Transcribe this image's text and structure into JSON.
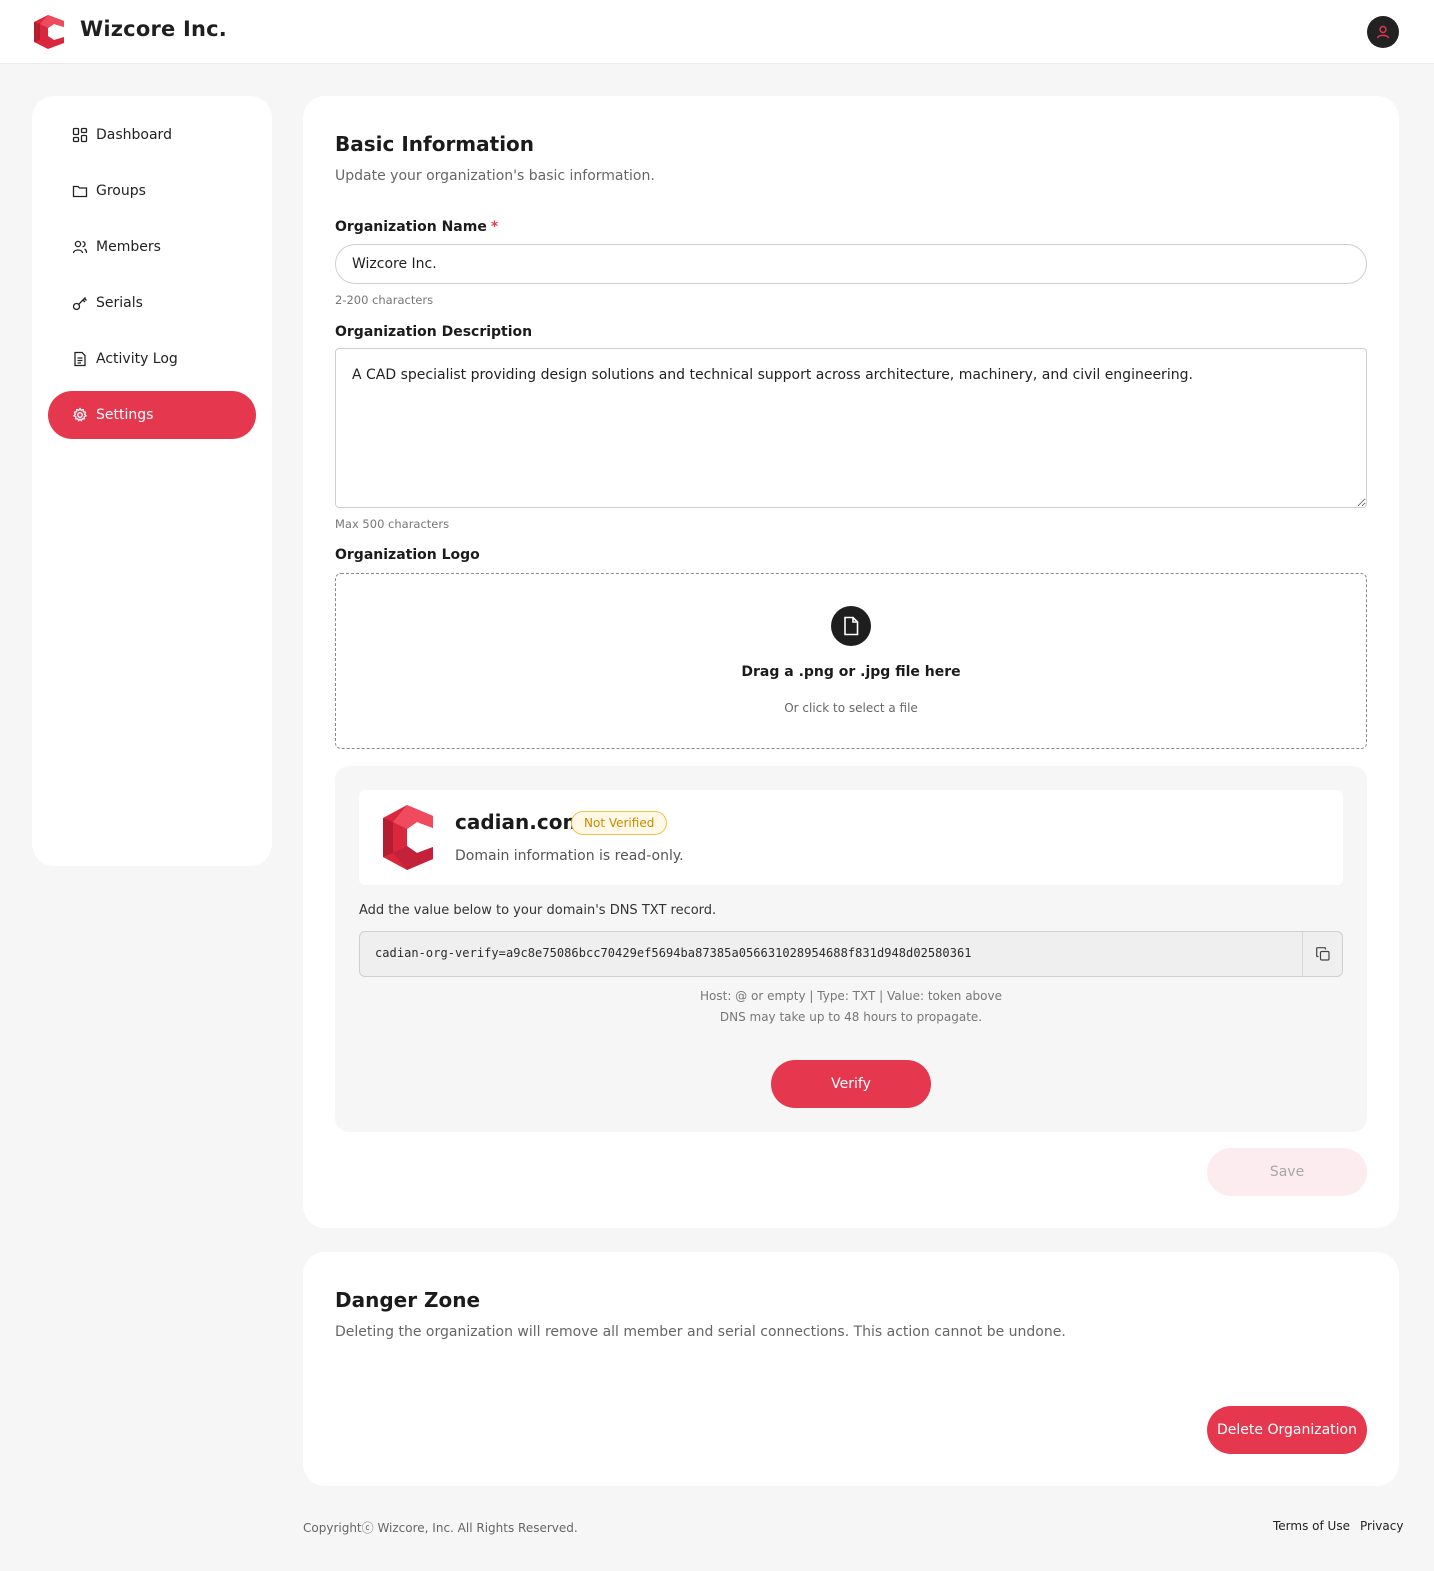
{
  "app": {
    "org_name": "Wizcore Inc.",
    "brand_color": "#e5384f"
  },
  "sidebar": {
    "items": [
      {
        "label": "Dashboard",
        "icon": "dashboard-icon"
      },
      {
        "label": "Groups",
        "icon": "folder-icon"
      },
      {
        "label": "Members",
        "icon": "users-icon"
      },
      {
        "label": "Serials",
        "icon": "key-icon"
      },
      {
        "label": "Activity Log",
        "icon": "document-icon"
      },
      {
        "label": "Settings",
        "icon": "gear-icon",
        "active": true
      }
    ]
  },
  "basic": {
    "title": "Basic Information",
    "subtitle": "Update your organization's basic information.",
    "name_label": "Organization Name",
    "required_mark": "*",
    "name_value": "Wizcore Inc.",
    "name_hint": "2-200 characters",
    "desc_label": "Organization Description",
    "desc_value": "A CAD specialist providing design solutions and technical support across architecture, machinery, and civil engineering.",
    "desc_hint": "Max 500 characters",
    "logo_label": "Organization Logo",
    "logo_drop_title": "Drag a .png or .jpg file here",
    "logo_drop_sub": "Or click to select a file",
    "save_label": "Save"
  },
  "domain": {
    "name": "cadian.com",
    "status": "Not Verified",
    "note": "Domain information is read-only.",
    "instruction": "Add the value below to your domain's DNS TXT record.",
    "token": "cadian-org-verify=a9c8e75086bcc70429ef5694ba87385a056631028954688f831d948d02580361",
    "hint_1": "Host: @ or empty | Type: TXT | Value: token above",
    "hint_2": "DNS may take up to 48 hours to propagate.",
    "verify_label": "Verify"
  },
  "danger": {
    "title": "Danger Zone",
    "description": "Deleting the organization will remove all member and serial connections. This action cannot be undone.",
    "delete_label": "Delete Organization"
  },
  "footer": {
    "copyright": "Copyrightⓒ Wizcore, Inc. All Rights Reserved.",
    "terms": "Terms of Use",
    "privacy": "Privacy"
  }
}
